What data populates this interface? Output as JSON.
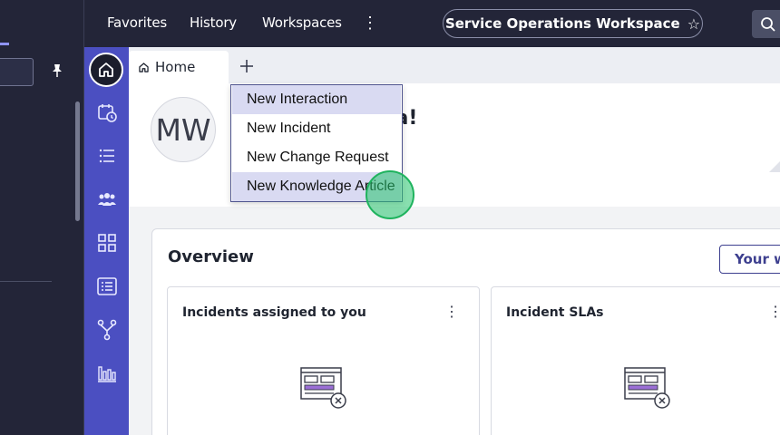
{
  "topnav": {
    "links": [
      "Favorites",
      "History",
      "Workspaces"
    ],
    "workspace": "Service Operations Workspace"
  },
  "tabs": {
    "home_label": "Home"
  },
  "greeting": {
    "avatar_initials": "MW",
    "text_visible": "la!"
  },
  "menu": {
    "items": [
      "New Interaction",
      "New Incident",
      "New Change Request",
      "New Knowledge Article"
    ],
    "highlighted_index": 3
  },
  "overview": {
    "title": "Overview",
    "button_label": "Your we",
    "cards": [
      {
        "title": "Incidents assigned to you"
      },
      {
        "title": "Incident SLAs"
      }
    ]
  },
  "colors": {
    "topbar": "#232538",
    "rail": "#4b4fc1",
    "accent_button": "#3d3f8f",
    "menu_highlight": "#d9daf2"
  }
}
